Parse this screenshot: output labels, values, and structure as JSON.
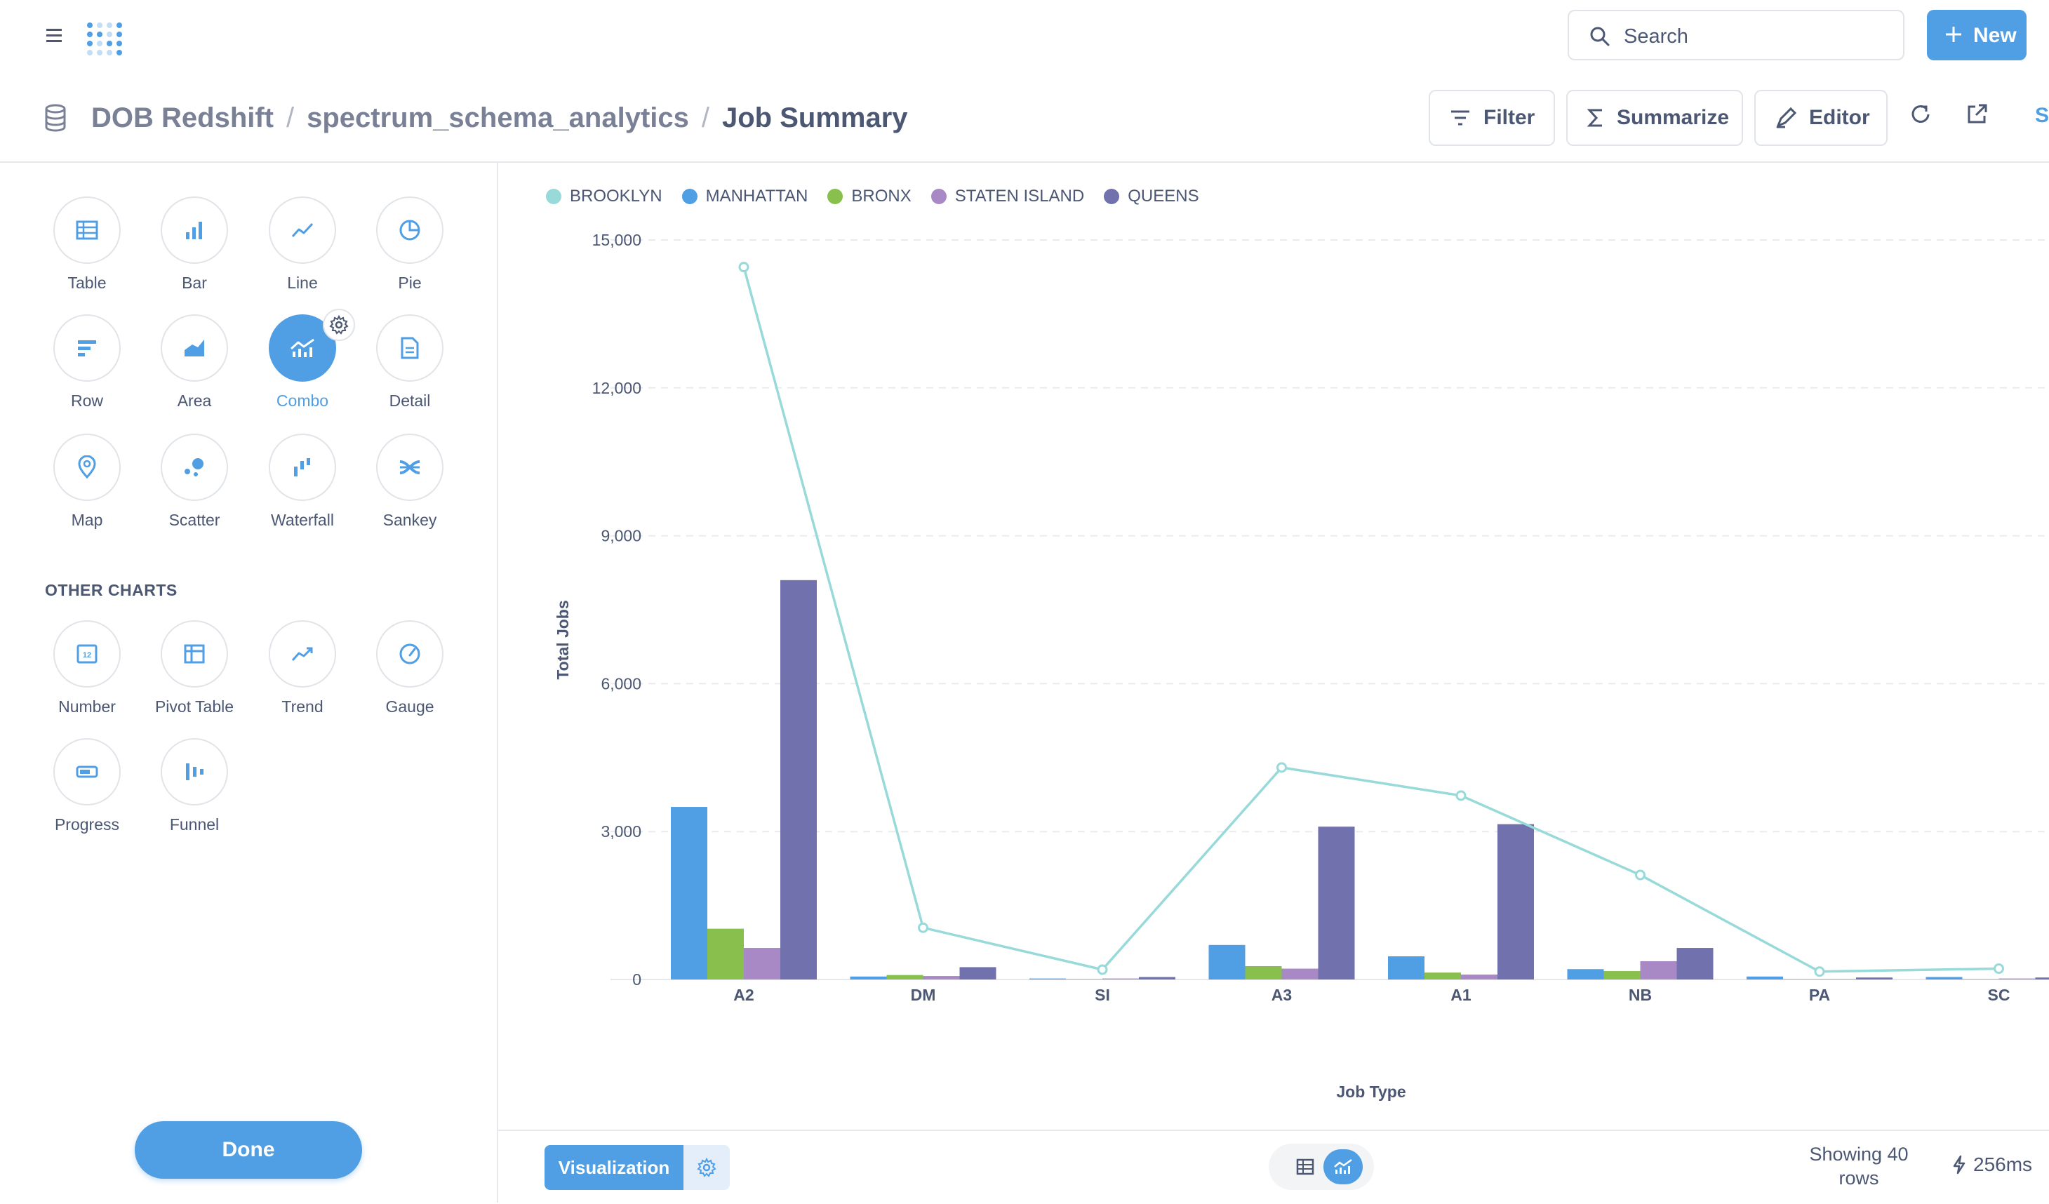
{
  "header": {
    "search_label": "Search",
    "new_label": "New",
    "breadcrumb": {
      "database": "DOB Redshift",
      "schema": "spectrum_schema_analytics",
      "question": "Job Summary"
    },
    "actions": {
      "filter": "Filter",
      "summarize": "Summarize",
      "editor": "Editor",
      "save_partial": "Sa"
    }
  },
  "sidebar": {
    "chart_types": [
      {
        "label": "Table",
        "icon": "table-icon"
      },
      {
        "label": "Bar",
        "icon": "bar-chart-icon"
      },
      {
        "label": "Line",
        "icon": "line-chart-icon"
      },
      {
        "label": "Pie",
        "icon": "pie-chart-icon"
      },
      {
        "label": "Row",
        "icon": "row-chart-icon"
      },
      {
        "label": "Area",
        "icon": "area-chart-icon"
      },
      {
        "label": "Combo",
        "icon": "combo-chart-icon"
      },
      {
        "label": "Detail",
        "icon": "document-icon"
      },
      {
        "label": "Map",
        "icon": "map-pin-icon"
      },
      {
        "label": "Scatter",
        "icon": "scatter-icon"
      },
      {
        "label": "Waterfall",
        "icon": "waterfall-icon"
      },
      {
        "label": "Sankey",
        "icon": "sankey-icon"
      }
    ],
    "other_title": "OTHER CHARTS",
    "other_types": [
      {
        "label": "Number",
        "icon": "number-icon"
      },
      {
        "label": "Pivot Table",
        "icon": "pivot-table-icon"
      },
      {
        "label": "Trend",
        "icon": "trend-icon"
      },
      {
        "label": "Gauge",
        "icon": "gauge-icon"
      },
      {
        "label": "Progress",
        "icon": "progress-icon"
      },
      {
        "label": "Funnel",
        "icon": "funnel-icon"
      }
    ],
    "selected": "Combo",
    "done_label": "Done"
  },
  "chart_data": {
    "type": "bar",
    "xlabel": "Job Type",
    "ylabel": "Total Jobs",
    "ylim": [
      0,
      15000
    ],
    "yticks": [
      "0",
      "3,000",
      "6,000",
      "9,000",
      "12,000",
      "15,000"
    ],
    "ytick_values": [
      0,
      3000,
      6000,
      9000,
      12000,
      15000
    ],
    "categories": [
      "A2",
      "DM",
      "SI",
      "A3",
      "A1",
      "NB",
      "PA",
      "SC"
    ],
    "grid": true,
    "legend_placement": "top-left",
    "series": [
      {
        "name": "BROOKLYN",
        "render": "line",
        "color": "#98d9d9",
        "values": [
          14450,
          1050,
          200,
          4300,
          3730,
          2120,
          160,
          220
        ]
      },
      {
        "name": "MANHATTAN",
        "render": "bar",
        "color": "#509ee3",
        "values": [
          3500,
          60,
          20,
          700,
          470,
          210,
          60,
          50
        ]
      },
      {
        "name": "BRONX",
        "render": "bar",
        "color": "#88bf4d",
        "values": [
          1030,
          90,
          10,
          270,
          140,
          170,
          10,
          10
        ]
      },
      {
        "name": "STATEN ISLAND",
        "render": "bar",
        "color": "#a989c5",
        "values": [
          640,
          70,
          20,
          220,
          100,
          370,
          10,
          20
        ]
      },
      {
        "name": "QUEENS",
        "render": "bar",
        "color": "#7172ad",
        "values": [
          8100,
          250,
          50,
          3100,
          3150,
          640,
          40,
          40
        ]
      }
    ]
  },
  "footer": {
    "visualization_label": "Visualization",
    "rows_line1": "Showing 40",
    "rows_line2": "rows",
    "timing": "256ms"
  },
  "colors": {
    "brand": "#509ee3",
    "text": "#4c5773",
    "border": "#e1e4e8"
  }
}
